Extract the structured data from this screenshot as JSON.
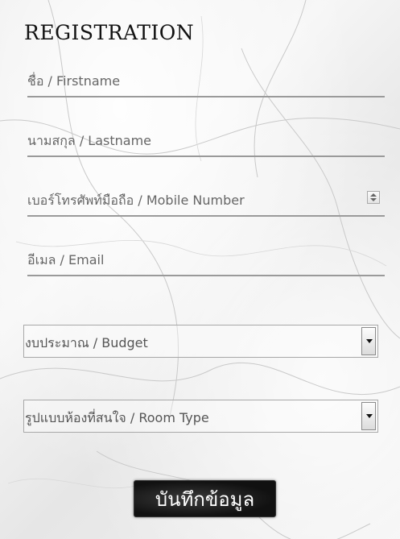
{
  "form": {
    "title": "REGISTRATION",
    "firstname_placeholder": "ชื่อ / Firstname",
    "lastname_placeholder": "นามสกุล / Lastname",
    "mobile_placeholder": "เบอร์โทรศัพท์มือถือ / Mobile Number",
    "email_placeholder": "อีเมล / Email",
    "budget_selected": "งบประมาณ / Budget",
    "roomtype_selected": "รูปแบบห้องที่สนใจ / Room Type",
    "submit_label": "บันทึกข้อมูล"
  },
  "colors": {
    "background": "#eeeeee",
    "underline": "#9a9a9a",
    "button_bg": "#111111",
    "text": "#555555"
  },
  "icons": [
    "spinner-icon",
    "dropdown-arrow-icon"
  ]
}
